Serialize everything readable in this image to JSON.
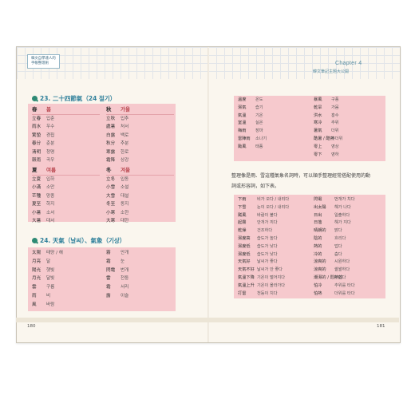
{
  "header": {
    "left_box_line1": "韓文自學達人的",
    "left_box_line2": "手帳整理術",
    "chapter_label": "Chapter 4",
    "chapter_subtitle": "韓文筆記主題大公開"
  },
  "page_numbers": {
    "left": "180",
    "right": "181"
  },
  "section23": {
    "title": "23. 二十四節氣（24 절기）",
    "spring": {
      "head_han": "春",
      "head_ko": "봄",
      "rows": [
        [
          "立春",
          "입춘"
        ],
        [
          "雨水",
          "우수"
        ],
        [
          "驚蟄",
          "경칩"
        ],
        [
          "春分",
          "춘분"
        ],
        [
          "清明",
          "청명"
        ],
        [
          "穀雨",
          "곡우"
        ]
      ]
    },
    "autumn": {
      "head_han": "秋",
      "head_ko": "가을",
      "rows": [
        [
          "立秋",
          "입추"
        ],
        [
          "處暑",
          "처서"
        ],
        [
          "白露",
          "백로"
        ],
        [
          "秋分",
          "추분"
        ],
        [
          "寒露",
          "한로"
        ],
        [
          "霜降",
          "상강"
        ]
      ]
    },
    "summer": {
      "head_han": "夏",
      "head_ko": "여름",
      "rows": [
        [
          "立夏",
          "입하"
        ],
        [
          "小滿",
          "소만"
        ],
        [
          "芒種",
          "망종"
        ],
        [
          "夏至",
          "하지"
        ],
        [
          "小暑",
          "소서"
        ],
        [
          "大暑",
          "대서"
        ]
      ]
    },
    "winter": {
      "head_han": "冬",
      "head_ko": "겨울",
      "rows": [
        [
          "立冬",
          "입동"
        ],
        [
          "小雪",
          "소설"
        ],
        [
          "大雪",
          "대설"
        ],
        [
          "冬至",
          "동지"
        ],
        [
          "小寒",
          "소한"
        ],
        [
          "大寒",
          "대한"
        ]
      ]
    }
  },
  "section24": {
    "title": "24. 天氣（날씨）、氣象（기상）",
    "left_rows": [
      [
        "太陽",
        "태양 / 해"
      ],
      [
        "月亮",
        "달"
      ],
      [
        "陽光",
        "햇빛"
      ],
      [
        "月光",
        "달빛"
      ],
      [
        "雲",
        "구름"
      ],
      [
        "雨",
        "비"
      ],
      [
        "風",
        "바람"
      ]
    ],
    "right_rows": [
      [
        "霧",
        "안개"
      ],
      [
        "霜",
        "눈"
      ],
      [
        "閃電",
        "번개"
      ],
      [
        "雷",
        "천둥"
      ],
      [
        "霜",
        "서리"
      ],
      [
        "露",
        "이슬"
      ]
    ]
  },
  "right_top_box": {
    "rows": [
      [
        "溫度",
        "온도"
      ],
      [
        "濕氣",
        "습기"
      ],
      [
        "氣溫",
        "기온"
      ],
      [
        "室溫",
        "실온"
      ],
      [
        "梅雨",
        "장마"
      ],
      [
        "雷陣雨",
        "소나기"
      ],
      [
        "颱風",
        "태풍"
      ]
    ],
    "rows2": [
      [
        "暴風",
        "구풍"
      ],
      [
        "乾旱",
        "가뭄"
      ],
      [
        "洪水",
        "홍수"
      ],
      [
        "寒冷",
        "추위"
      ],
      [
        "暑氣",
        "더위"
      ],
      [
        "酷暑 / 酷熱",
        "무더위"
      ],
      [
        "零上",
        "영상"
      ],
      [
        "零下",
        "영하"
      ]
    ]
  },
  "paragraph": "整理像是雨、雪這種氣象名詞時，可以順手整理經常搭配使用的動詞或形容詞，如下表。",
  "bottom_box": {
    "left_rows": [
      [
        "下雨",
        "비가 오다 / 내리다"
      ],
      [
        "下雪",
        "눈이 오다 / 내리다"
      ],
      [
        "颳風",
        "바람이 불다"
      ],
      [
        "起霧",
        "안개가 끼다"
      ],
      [
        "乾燥",
        "건조하다"
      ],
      [
        "濕度高",
        "습도가 높다"
      ],
      [
        "濕度低",
        "습도가 낮다"
      ],
      [
        "濕度低",
        "습도가 낮다"
      ],
      [
        "天氣好",
        "날씨가 좋다"
      ],
      [
        "天氣不好",
        "날씨가 안 좋다"
      ],
      [
        "氣溫下降",
        "기온이 떨어지다"
      ],
      [
        "氣溫上升",
        "기온이 올라가다"
      ],
      [
        "打雷",
        "천둥이 치다"
      ]
    ],
    "right_rows": [
      [
        "閃電",
        "번개가 치다"
      ],
      [
        "出太陽",
        "해가 나다"
      ],
      [
        "日出",
        "일출하다"
      ],
      [
        "日落",
        "해가 지다"
      ],
      [
        "晴朗的",
        "맑다"
      ],
      [
        "陰的",
        "흐리다"
      ],
      [
        "熱的",
        "덥다"
      ],
      [
        "冷的",
        "춥다"
      ],
      [
        "涼爽的",
        "시원하다"
      ],
      [
        "涼爽的",
        "쌀쌀하다"
      ],
      [
        "潮濕的 / 悶熱的",
        "무덥다"
      ],
      [
        "怕冷",
        "추위를 타다"
      ],
      [
        "怕熱",
        "더위를 타다"
      ]
    ]
  }
}
